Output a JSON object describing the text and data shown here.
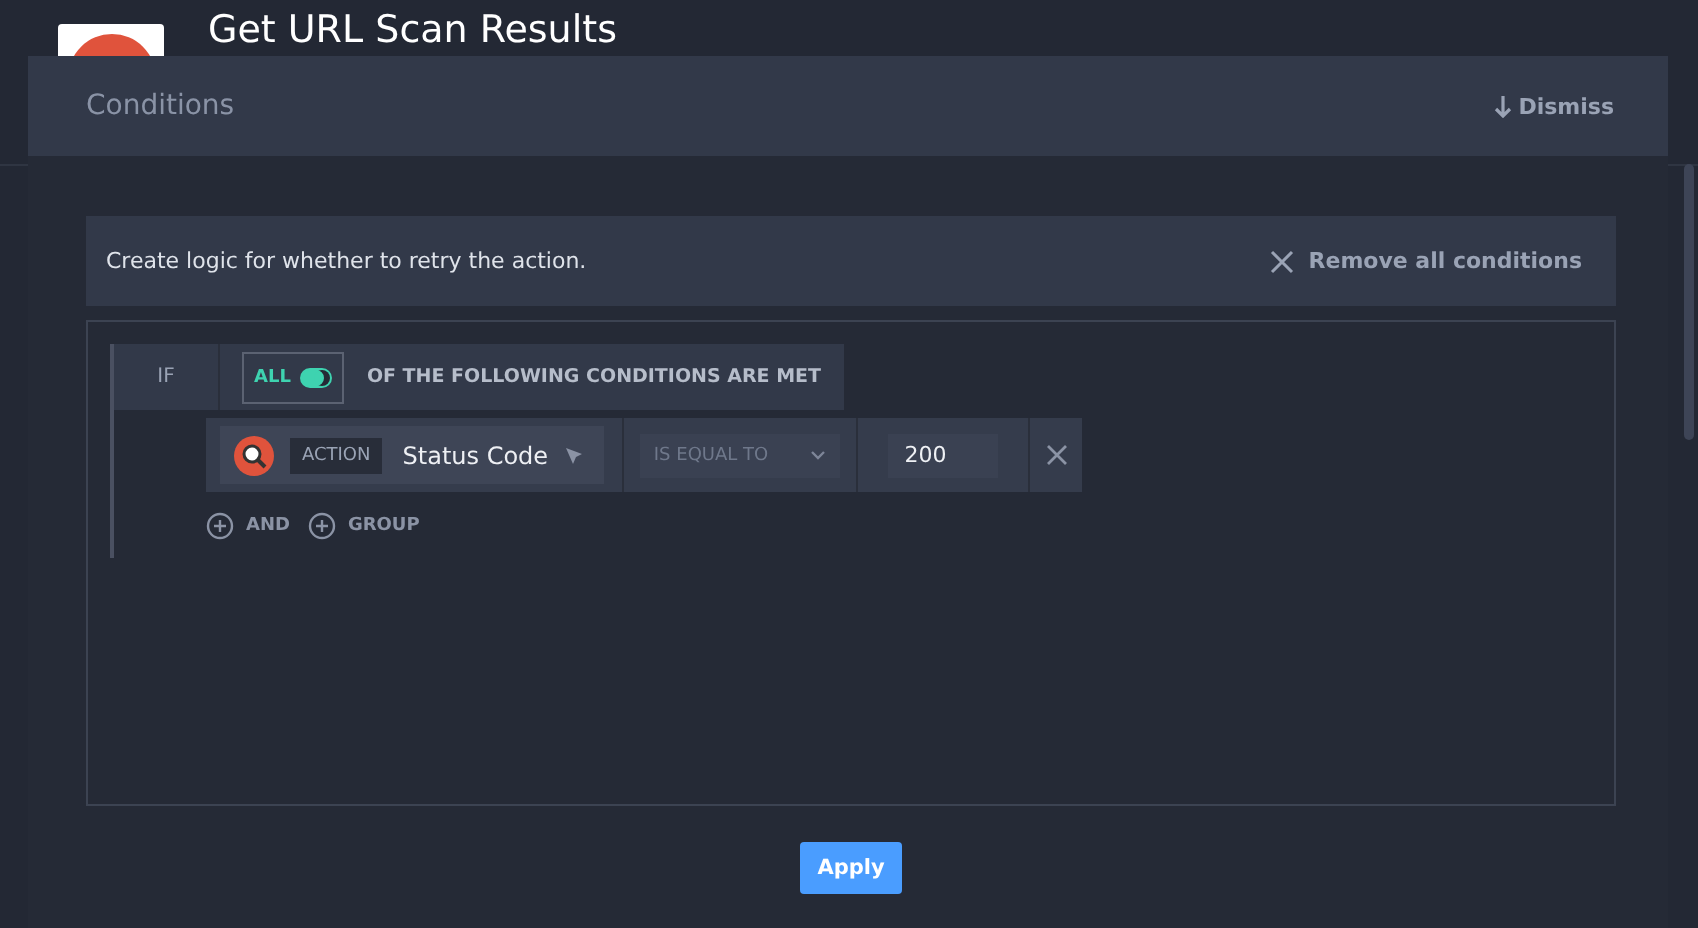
{
  "page": {
    "title": "Get URL Scan Results"
  },
  "modal": {
    "title": "Conditions",
    "dismiss": "Dismiss"
  },
  "info": {
    "text": "Create logic for whether to retry the action.",
    "remove": "Remove all conditions"
  },
  "rule": {
    "if": "IF",
    "mode": {
      "label": "ALL",
      "on": true
    },
    "suffix": "OF THE FOLLOWING CONDITIONS ARE MET"
  },
  "conditions": [
    {
      "source": "ACTION",
      "field": "Status Code",
      "operator": "IS EQUAL TO",
      "value": "200"
    }
  ],
  "add_buttons": [
    "AND",
    "GROUP"
  ],
  "apply": "Apply"
}
